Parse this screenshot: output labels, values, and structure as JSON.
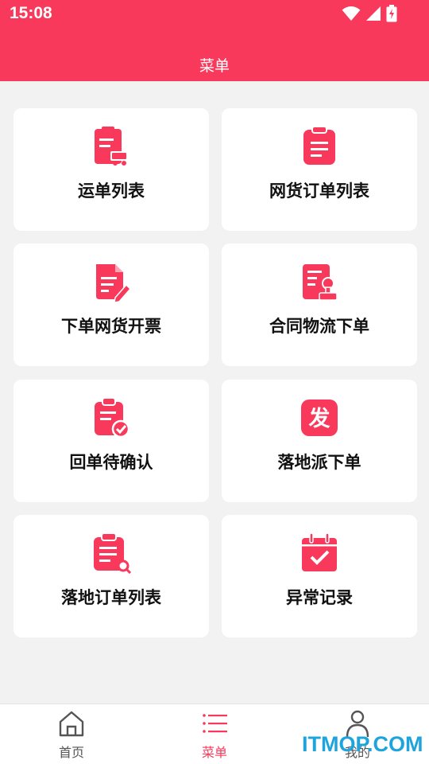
{
  "status_bar": {
    "time": "15:08"
  },
  "header": {
    "title": "菜单"
  },
  "menu": [
    {
      "label": "运单列表",
      "icon": "waybill-list-icon"
    },
    {
      "label": "网货订单列表",
      "icon": "clipboard-list-icon"
    },
    {
      "label": "下单网货开票",
      "icon": "invoice-edit-icon"
    },
    {
      "label": "合同物流下单",
      "icon": "contract-stamp-icon"
    },
    {
      "label": "回单待确认",
      "icon": "receipt-check-icon"
    },
    {
      "label": "落地派下单",
      "icon": "dispatch-fa-icon"
    },
    {
      "label": "落地订单列表",
      "icon": "order-search-icon"
    },
    {
      "label": "异常记录",
      "icon": "calendar-check-icon"
    }
  ],
  "tabbar": {
    "items": [
      {
        "label": "首页",
        "icon": "home-icon",
        "active": false
      },
      {
        "label": "菜单",
        "icon": "menu-list-icon",
        "active": true
      },
      {
        "label": "我的",
        "icon": "person-icon",
        "active": false
      }
    ]
  },
  "watermark": {
    "text": "ITMOP.COM"
  },
  "colors": {
    "accent": "#f8395b",
    "background": "#f2f2f2",
    "card": "#ffffff"
  }
}
